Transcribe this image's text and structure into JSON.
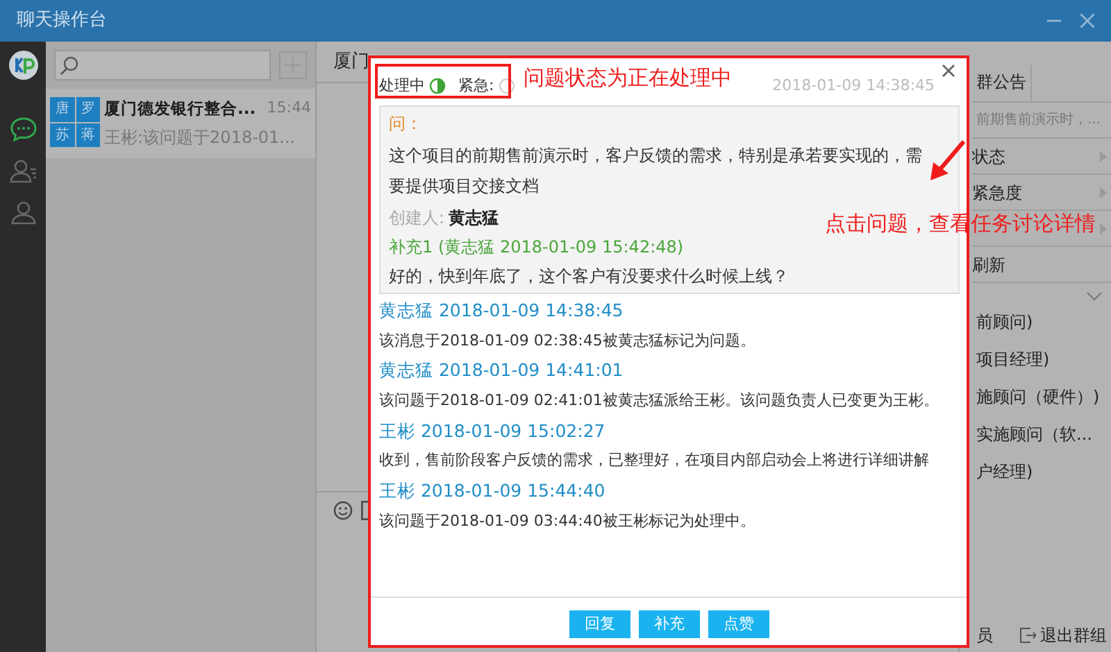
{
  "window": {
    "title": "聊天操作台"
  },
  "rail": {
    "items": [
      {
        "kind": "chat",
        "selected": true
      },
      {
        "kind": "contacts",
        "selected": false
      },
      {
        "kind": "groups",
        "selected": false
      }
    ]
  },
  "conversations": [
    {
      "avatar_names": [
        "唐",
        "罗",
        "苏",
        "蒋"
      ],
      "name": "厦门德发银行整合...",
      "time": "15:44",
      "preview": "王彬:该问题于2018-01...",
      "selected": true
    }
  ],
  "chat": {
    "title": "厦门"
  },
  "side_panel": {
    "tab": "群公告",
    "notice": "前期售前演示时，...",
    "menu": [
      {
        "label": "状态",
        "submenu": true
      },
      {
        "label": "紧急度",
        "submenu": true
      },
      {
        "submenu": true
      },
      {
        "label": "刷新",
        "submenu": false
      }
    ],
    "members": [
      "前顾问)",
      "项目经理)",
      "施顾问（硬件）)",
      "实施顾问（软...",
      "户经理)"
    ],
    "footer": [
      "员",
      "退出群组"
    ]
  },
  "dialog": {
    "status": {
      "label": "处理中"
    },
    "urgent": {
      "label": "紧急:",
      "on": false
    },
    "time": "2018-01-09 14:38:45",
    "question": {
      "heading": "问：",
      "text": "这个项目的前期售前演示时，客户反馈的需求，特别是承若要实现的，需要提供项目交接文档",
      "creator_label": "创建人:",
      "creator": "黄志猛",
      "supplements": [
        {
          "title": "补充1 (黄志猛 2018-01-09 15:42:48)",
          "text": "好的，快到年底了，这个客户有没要求什么时候上线？"
        }
      ]
    },
    "log": [
      {
        "header": "黄志猛 2018-01-09 14:38:45",
        "text": "该消息于2018-01-09 02:38:45被黄志猛标记为问题。"
      },
      {
        "header": "黄志猛 2018-01-09 14:41:01",
        "text": "该问题于2018-01-09 02:41:01被黄志猛派给王彬。该问题负责人已变更为王彬。"
      },
      {
        "header": "王彬 2018-01-09 15:02:27",
        "text": "收到，售前阶段客户反馈的需求，已整理好，在项目内部启动会上将进行详细讲解"
      },
      {
        "header": "王彬 2018-01-09 15:44:40",
        "text": "该问题于2018-01-09 03:44:40被王彬标记为处理中。"
      }
    ],
    "buttons": [
      "回复",
      "补充",
      "点赞"
    ]
  },
  "annotations": [
    {
      "text": "问题状态为正在处理中"
    },
    {
      "text": "点击问题，查看任务讨论详情"
    }
  ]
}
